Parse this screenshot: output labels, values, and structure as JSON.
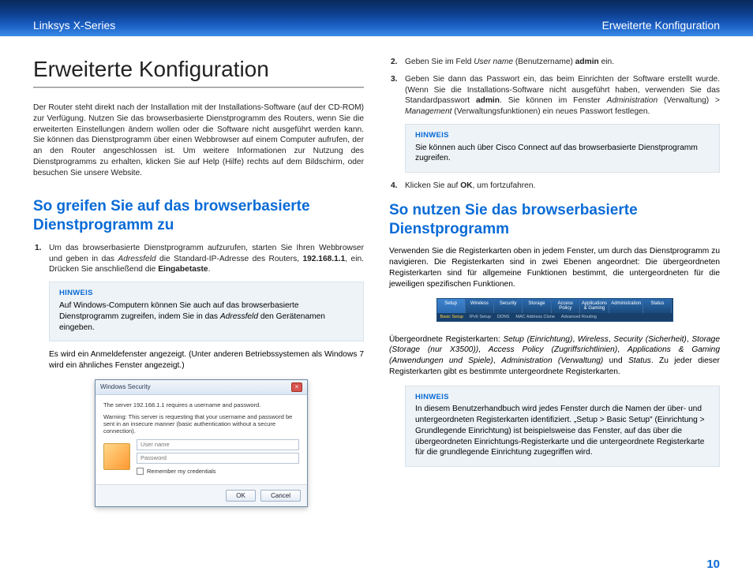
{
  "header": {
    "left": "Linksys X-Series",
    "right": "Erweiterte Konfiguration"
  },
  "page_number": "10",
  "left": {
    "h1": "Erweiterte Konfiguration",
    "intro": "Der Router steht direkt nach der Installation mit der Installations-Software (auf der CD-ROM) zur Verfügung. Nutzen Sie das browserbasierte Dienstprogramm des Routers, wenn Sie die erweiterten Einstellungen ändern wollen oder die Software nicht ausgeführt werden kann. Sie können das Dienstprogramm über einen Webbrowser auf einem Computer aufrufen, der an den Router angeschlossen ist. Um weitere Informationen zur Nutzung des Dienstprogramms zu erhalten, klicken Sie auf Help (Hilfe) rechts auf dem Bildschirm, oder besuchen Sie unsere Website.",
    "h2": "So greifen Sie auf das browserbasierte Dienstprogramm zu",
    "step1_pre": "Um das browserbasierte Dienstprogramm aufzurufen, starten Sie Ihren Webbrowser und geben in das ",
    "step1_i1": "Adressfeld",
    "step1_mid": " die Standard-IP-Adresse des Routers, ",
    "step1_b1": "192.168.1.1",
    "step1_mid2": ", ein. Drücken Sie anschließend die ",
    "step1_b2": "Eingabetaste",
    "hinweis_label": "HINWEIS",
    "hinweis1_pre": "Auf Windows-Computern können Sie auch auf das browserbasierte Dienstprogramm zugreifen, indem Sie in das ",
    "hinweis1_i": "Adressfeld",
    "hinweis1_post": " den Gerätenamen eingeben.",
    "after1": "Es wird ein Anmeldefenster angezeigt. (Unter anderen Betriebssystemen als Windows 7 wird ein ähnliches Fenster angezeigt.)"
  },
  "dialog": {
    "title": "Windows Security",
    "line1": "The server 192.168.1.1 requires a username and password.",
    "line2": "Warning: This server is requesting that your username and password be sent in an insecure manner (basic authentication without a secure connection).",
    "user_ph": "User name",
    "pass_ph": "Password",
    "remember": "Remember my credentials",
    "ok": "OK",
    "cancel": "Cancel"
  },
  "right": {
    "step2_pre": "Geben Sie im Feld ",
    "step2_i": "User name",
    "step2_mid": " (Benutzername) ",
    "step2_b": "admin",
    "step2_post": " ein.",
    "step3_pre": "Geben Sie dann das Passwort ein, das beim Einrichten der Software erstellt wurde. (Wenn Sie die Installations-Software nicht ausgeführt haben, verwenden Sie das Standardpasswort ",
    "step3_b": "admin",
    "step3_mid": ". Sie können im Fenster ",
    "step3_i1": "Administration",
    "step3_mid2": " (Verwaltung) > ",
    "step3_i2": "Management",
    "step3_post": " (Verwaltungsfunktionen) ein neues Passwort festlegen.",
    "hinweis2": "Sie können auch über Cisco Connect auf das browserbasierte Dienstprogramm zugreifen.",
    "step4_pre": "Klicken Sie auf ",
    "step4_b": "OK",
    "step4_post": ", um fortzufahren.",
    "h2": "So nutzen Sie das browserbasierte Dienstprogramm",
    "desc": "Verwenden Sie die Registerkarten oben in jedem Fenster, um durch das Dienstprogramm zu navigieren. Die Registerkarten sind in zwei Ebenen angeordnet: Die übergeordneten Registerkarten sind für allgemeine Funktionen bestimmt, die untergeordneten für die jeweiligen spezifischen Funktionen.",
    "tabs_desc_pre": "Übergeordnete Registerkarten: ",
    "tabs_i1": "Setup (Einrichtung)",
    "tabs_i2": "Wireless",
    "tabs_i3": "Security (Sicherheit)",
    "tabs_i4": "Storage (Storage (nur X3500))",
    "tabs_i5": "Access Policy (Zugriffsrichtlinien)",
    "tabs_i6": "Applications & Gaming (Anwendungen und Spiele)",
    "tabs_i7": "Administration (Verwaltung)",
    "tabs_and": " und ",
    "tabs_i8": "Status",
    "tabs_desc_post": ". Zu jeder dieser Registerkarten gibt es bestimmte untergeordnete Registerkarten.",
    "hinweis3": "In diesem Benutzerhandbuch wird jedes Fenster durch die Namen der über- und untergeordneten Registerkarten identifiziert. „Setup > Basic Setup\" (Einrichtung > Grundlegende Einrichtung) ist beispielsweise das Fenster, auf das über die übergeordneten Einrichtungs-Registerkarte und die untergeordnete Registerkarte für die grundlegende Einrichtung zugegriffen wird."
  },
  "nav": {
    "t1": "Setup",
    "t2": "Wireless",
    "t3": "Security",
    "t4": "Storage",
    "t5": "Access Policy",
    "t6": "Applications & Gaming",
    "t7": "Administration",
    "t8": "Status",
    "s1": "Basic Setup",
    "s2": "IPv6 Setup",
    "s3": "DDNS",
    "s4": "MAC Address Clone",
    "s5": "Advanced Routing"
  }
}
